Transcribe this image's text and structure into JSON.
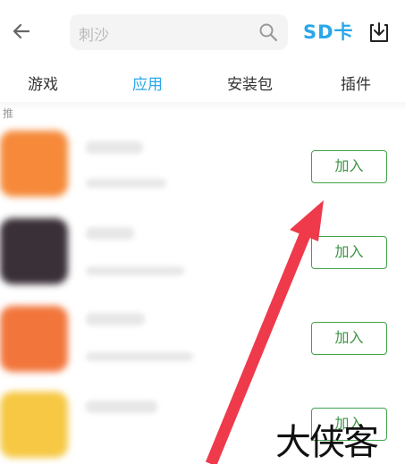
{
  "header": {
    "search_placeholder": "刺沙",
    "sd_label": "SD卡"
  },
  "tabs": [
    {
      "label": "游戏",
      "active": false
    },
    {
      "label": "应用",
      "active": true
    },
    {
      "label": "安装包",
      "active": false
    },
    {
      "label": "插件",
      "active": false
    }
  ],
  "list_hint": "推",
  "apps": [
    {
      "icon_color": "#f68a3a",
      "add_label": "加入"
    },
    {
      "icon_color": "#3a3038",
      "add_label": "加入"
    },
    {
      "icon_color": "#f2763c",
      "add_label": "加入"
    },
    {
      "icon_color": "#f6c843",
      "add_label": "加入"
    }
  ],
  "watermark": "大侠客",
  "colors": {
    "accent": "#2aa7ea",
    "add_green": "#3b9444",
    "arrow": "#ee3a4b"
  }
}
